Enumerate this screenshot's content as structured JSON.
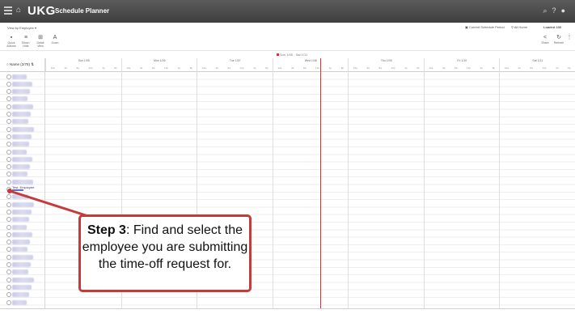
{
  "topbar": {
    "logo": "UKG",
    "title": "Schedule Planner",
    "icons": [
      "search-icon",
      "help-icon",
      "user-icon"
    ]
  },
  "view_label": "View by Employee ▾",
  "period_label": "Current Schedule Period",
  "hours_label": "All Home",
  "loaded_label": "Loaded",
  "loaded_count": "230",
  "toolbar": {
    "left": [
      {
        "icon": "save-icon",
        "label": "Quick Actions"
      },
      {
        "icon": "menu-icon",
        "label": "Show / Hide"
      },
      {
        "icon": "table-icon",
        "label": "Detail View"
      },
      {
        "icon": "text-icon",
        "label": "Zoom"
      }
    ],
    "right": [
      {
        "icon": "share-icon",
        "label": "Share"
      },
      {
        "icon": "refresh-icon",
        "label": "Refresh"
      },
      {
        "icon": "more-icon",
        "label": ""
      }
    ]
  },
  "date_range": "Sun 1/05 - Sat 1/11",
  "name_header": "Name (2/78)",
  "days": [
    "Sun 1/05",
    "Mon 1/06",
    "Tue 1/07",
    "Wed 1/08",
    "Thu 1/09",
    "Fri 1/10",
    "Sat 1/11"
  ],
  "hour_ticks": [
    "12a",
    "4a",
    "8a",
    "12p",
    "4p",
    "8p"
  ],
  "employee_name": "Test, Employee",
  "callout": {
    "step": "Step 3",
    "text": ": Find and select the employee you are submitting the time-off request for."
  },
  "colors": {
    "topbar": "#444444",
    "accent_red": "#d33333",
    "callout_border": "#c43b3b",
    "employee_link": "#2a3c8a"
  }
}
